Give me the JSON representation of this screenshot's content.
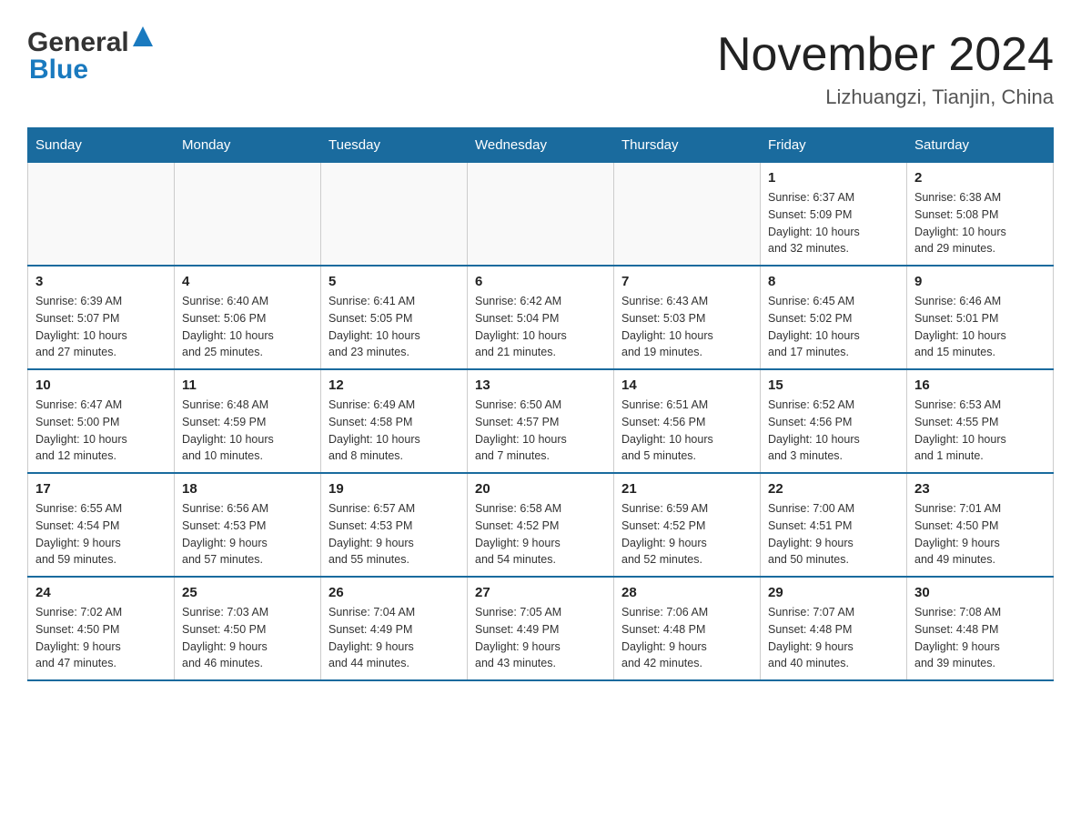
{
  "header": {
    "logo_general": "General",
    "logo_blue": "Blue",
    "month_title": "November 2024",
    "location": "Lizhuangzi, Tianjin, China"
  },
  "weekdays": [
    "Sunday",
    "Monday",
    "Tuesday",
    "Wednesday",
    "Thursday",
    "Friday",
    "Saturday"
  ],
  "weeks": [
    [
      {
        "day": "",
        "info": ""
      },
      {
        "day": "",
        "info": ""
      },
      {
        "day": "",
        "info": ""
      },
      {
        "day": "",
        "info": ""
      },
      {
        "day": "",
        "info": ""
      },
      {
        "day": "1",
        "info": "Sunrise: 6:37 AM\nSunset: 5:09 PM\nDaylight: 10 hours\nand 32 minutes."
      },
      {
        "day": "2",
        "info": "Sunrise: 6:38 AM\nSunset: 5:08 PM\nDaylight: 10 hours\nand 29 minutes."
      }
    ],
    [
      {
        "day": "3",
        "info": "Sunrise: 6:39 AM\nSunset: 5:07 PM\nDaylight: 10 hours\nand 27 minutes."
      },
      {
        "day": "4",
        "info": "Sunrise: 6:40 AM\nSunset: 5:06 PM\nDaylight: 10 hours\nand 25 minutes."
      },
      {
        "day": "5",
        "info": "Sunrise: 6:41 AM\nSunset: 5:05 PM\nDaylight: 10 hours\nand 23 minutes."
      },
      {
        "day": "6",
        "info": "Sunrise: 6:42 AM\nSunset: 5:04 PM\nDaylight: 10 hours\nand 21 minutes."
      },
      {
        "day": "7",
        "info": "Sunrise: 6:43 AM\nSunset: 5:03 PM\nDaylight: 10 hours\nand 19 minutes."
      },
      {
        "day": "8",
        "info": "Sunrise: 6:45 AM\nSunset: 5:02 PM\nDaylight: 10 hours\nand 17 minutes."
      },
      {
        "day": "9",
        "info": "Sunrise: 6:46 AM\nSunset: 5:01 PM\nDaylight: 10 hours\nand 15 minutes."
      }
    ],
    [
      {
        "day": "10",
        "info": "Sunrise: 6:47 AM\nSunset: 5:00 PM\nDaylight: 10 hours\nand 12 minutes."
      },
      {
        "day": "11",
        "info": "Sunrise: 6:48 AM\nSunset: 4:59 PM\nDaylight: 10 hours\nand 10 minutes."
      },
      {
        "day": "12",
        "info": "Sunrise: 6:49 AM\nSunset: 4:58 PM\nDaylight: 10 hours\nand 8 minutes."
      },
      {
        "day": "13",
        "info": "Sunrise: 6:50 AM\nSunset: 4:57 PM\nDaylight: 10 hours\nand 7 minutes."
      },
      {
        "day": "14",
        "info": "Sunrise: 6:51 AM\nSunset: 4:56 PM\nDaylight: 10 hours\nand 5 minutes."
      },
      {
        "day": "15",
        "info": "Sunrise: 6:52 AM\nSunset: 4:56 PM\nDaylight: 10 hours\nand 3 minutes."
      },
      {
        "day": "16",
        "info": "Sunrise: 6:53 AM\nSunset: 4:55 PM\nDaylight: 10 hours\nand 1 minute."
      }
    ],
    [
      {
        "day": "17",
        "info": "Sunrise: 6:55 AM\nSunset: 4:54 PM\nDaylight: 9 hours\nand 59 minutes."
      },
      {
        "day": "18",
        "info": "Sunrise: 6:56 AM\nSunset: 4:53 PM\nDaylight: 9 hours\nand 57 minutes."
      },
      {
        "day": "19",
        "info": "Sunrise: 6:57 AM\nSunset: 4:53 PM\nDaylight: 9 hours\nand 55 minutes."
      },
      {
        "day": "20",
        "info": "Sunrise: 6:58 AM\nSunset: 4:52 PM\nDaylight: 9 hours\nand 54 minutes."
      },
      {
        "day": "21",
        "info": "Sunrise: 6:59 AM\nSunset: 4:52 PM\nDaylight: 9 hours\nand 52 minutes."
      },
      {
        "day": "22",
        "info": "Sunrise: 7:00 AM\nSunset: 4:51 PM\nDaylight: 9 hours\nand 50 minutes."
      },
      {
        "day": "23",
        "info": "Sunrise: 7:01 AM\nSunset: 4:50 PM\nDaylight: 9 hours\nand 49 minutes."
      }
    ],
    [
      {
        "day": "24",
        "info": "Sunrise: 7:02 AM\nSunset: 4:50 PM\nDaylight: 9 hours\nand 47 minutes."
      },
      {
        "day": "25",
        "info": "Sunrise: 7:03 AM\nSunset: 4:50 PM\nDaylight: 9 hours\nand 46 minutes."
      },
      {
        "day": "26",
        "info": "Sunrise: 7:04 AM\nSunset: 4:49 PM\nDaylight: 9 hours\nand 44 minutes."
      },
      {
        "day": "27",
        "info": "Sunrise: 7:05 AM\nSunset: 4:49 PM\nDaylight: 9 hours\nand 43 minutes."
      },
      {
        "day": "28",
        "info": "Sunrise: 7:06 AM\nSunset: 4:48 PM\nDaylight: 9 hours\nand 42 minutes."
      },
      {
        "day": "29",
        "info": "Sunrise: 7:07 AM\nSunset: 4:48 PM\nDaylight: 9 hours\nand 40 minutes."
      },
      {
        "day": "30",
        "info": "Sunrise: 7:08 AM\nSunset: 4:48 PM\nDaylight: 9 hours\nand 39 minutes."
      }
    ]
  ]
}
